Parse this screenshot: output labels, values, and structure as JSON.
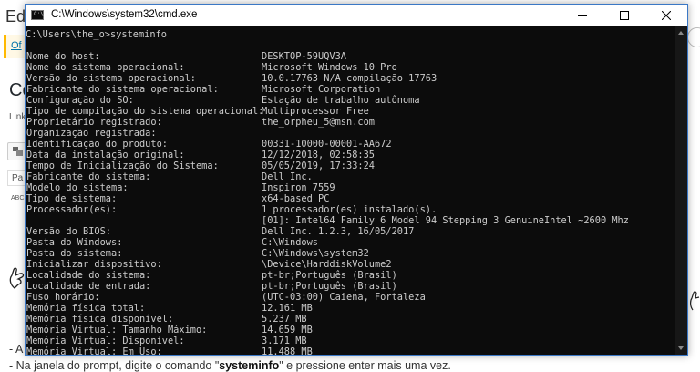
{
  "background_page": {
    "title_fragment": "Edi",
    "notice_link": "Of",
    "heading_fragment": "Co",
    "permalink_fragment": "Link",
    "format_fragment": "Pa",
    "abc_label": "ABC",
    "line1_prefix": "- A",
    "line2_before": "- Na janela do prompt, digite o comando \"",
    "line2_bold": "systeminfo",
    "line2_after": "\" e pressione enter mais uma vez."
  },
  "window": {
    "title": "C:\\Windows\\system32\\cmd.exe",
    "icon_glyph": "C:\\"
  },
  "console": {
    "prompt": "C:\\Users\\the_o>systeminfo",
    "rows": [
      {
        "k": "Nome do host:",
        "v": "DESKTOP-59UQV3A"
      },
      {
        "k": "Nome do sistema operacional:",
        "v": "Microsoft Windows 10 Pro"
      },
      {
        "k": "Versão do sistema operacional:",
        "v": "10.0.17763 N/A compilação 17763"
      },
      {
        "k": "Fabricante do sistema operacional:",
        "v": "Microsoft Corporation"
      },
      {
        "k": "Configuração do SO:",
        "v": "Estação de trabalho autônoma"
      },
      {
        "k": "Tipo de compilação do sistema operacional:",
        "v": "Multiprocessor Free"
      },
      {
        "k": "Proprietário registrado:",
        "v": "the_orpheu_5@msn.com"
      },
      {
        "k": "Organização registrada:",
        "v": ""
      },
      {
        "k": "Identificação do produto:",
        "v": "00331-10000-00001-AA672"
      },
      {
        "k": "Data da instalação original:",
        "v": "12/12/2018, 02:58:35"
      },
      {
        "k": "Tempo de Inicialização do Sistema:",
        "v": "05/05/2019, 17:33:24"
      },
      {
        "k": "Fabricante do sistema:",
        "v": "Dell Inc."
      },
      {
        "k": "Modelo do sistema:",
        "v": "Inspiron 7559"
      },
      {
        "k": "Tipo de sistema:",
        "v": "x64-based PC"
      },
      {
        "k": "Processador(es):",
        "v": "1 processador(es) instalado(s)."
      },
      {
        "k": "",
        "v": "[01]: Intel64 Family 6 Model 94 Stepping 3 GenuineIntel ~2600 Mhz"
      },
      {
        "k": "Versão do BIOS:",
        "v": "Dell Inc. 1.2.3, 16/05/2017"
      },
      {
        "k": "Pasta do Windows:",
        "v": "C:\\Windows"
      },
      {
        "k": "Pasta do sistema:",
        "v": "C:\\Windows\\system32"
      },
      {
        "k": "Inicializar dispositivo:",
        "v": "\\Device\\HarddiskVolume2"
      },
      {
        "k": "Localidade do sistema:",
        "v": "pt-br;Português (Brasil)"
      },
      {
        "k": "Localidade de entrada:",
        "v": "pt-br;Português (Brasil)"
      },
      {
        "k": "Fuso horário:",
        "v": "(UTC-03:00) Caiena, Fortaleza"
      },
      {
        "k": "Memória física total:",
        "v": "12.161 MB"
      },
      {
        "k": "Memória física disponível:",
        "v": "5.237 MB"
      },
      {
        "k": "Memória Virtual: Tamanho Máximo:",
        "v": "14.659 MB"
      },
      {
        "k": "Memória Virtual: Disponível:",
        "v": "3.171 MB"
      },
      {
        "k": "Memória Virtual: Em Uso:",
        "v": "11.488 MB"
      }
    ]
  },
  "colors": {
    "console_bg": "#0c0c0c",
    "console_text": "#cccccc",
    "window_border": "#3b78c6",
    "notice_accent": "#ffb900",
    "link": "#0073aa"
  },
  "icons": [
    "cmd-icon",
    "minimize-icon",
    "maximize-icon",
    "close-icon",
    "scroll-up-icon",
    "scroll-down-icon",
    "hand-icon",
    "toolbar-icon"
  ]
}
